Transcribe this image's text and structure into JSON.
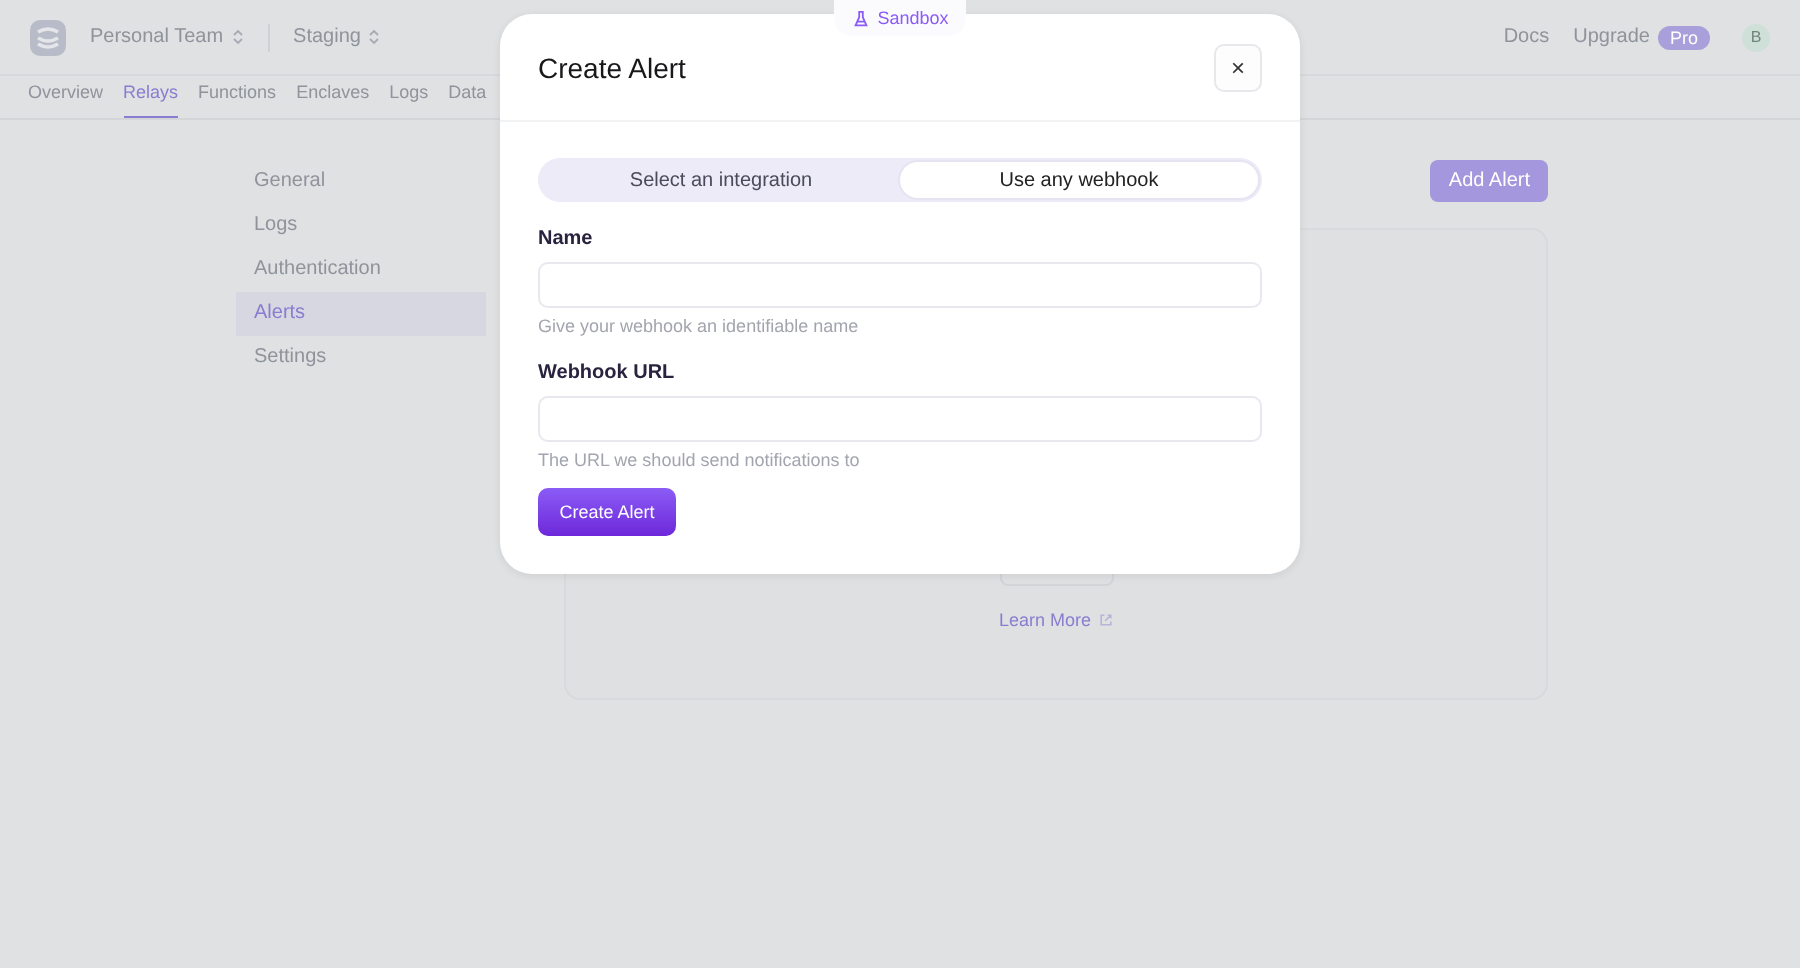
{
  "topbar": {
    "team": "Personal Team",
    "environment": "Staging",
    "links": [
      "Docs"
    ],
    "upgrade": "Upgrade",
    "plan_badge": "Pro",
    "avatar": "B"
  },
  "nav_tabs": [
    {
      "label": "Overview",
      "selected": false
    },
    {
      "label": "Relays",
      "selected": true
    },
    {
      "label": "Functions",
      "selected": false
    },
    {
      "label": "Enclaves",
      "selected": false
    },
    {
      "label": "Logs",
      "selected": false
    },
    {
      "label": "Data",
      "selected": false
    }
  ],
  "sidebar": {
    "items": [
      {
        "label": "General",
        "selected": false
      },
      {
        "label": "Logs",
        "selected": false
      },
      {
        "label": "Authentication",
        "selected": false
      },
      {
        "label": "Alerts",
        "selected": true
      },
      {
        "label": "Settings",
        "selected": false
      }
    ]
  },
  "content": {
    "add_button": "Add Alert",
    "learn_more": "Learn More"
  },
  "sandbox_tab": "Sandbox",
  "modal": {
    "title": "Create Alert",
    "close": "×",
    "segments": [
      {
        "label": "Select an integration",
        "selected": false
      },
      {
        "label": "Use any webhook",
        "selected": true
      }
    ],
    "fields": [
      {
        "label": "Name",
        "help": "Give your webhook an identifiable name"
      },
      {
        "label": "Webhook URL",
        "help": "The URL we should send notifications to"
      }
    ],
    "submit": "Create Alert"
  }
}
